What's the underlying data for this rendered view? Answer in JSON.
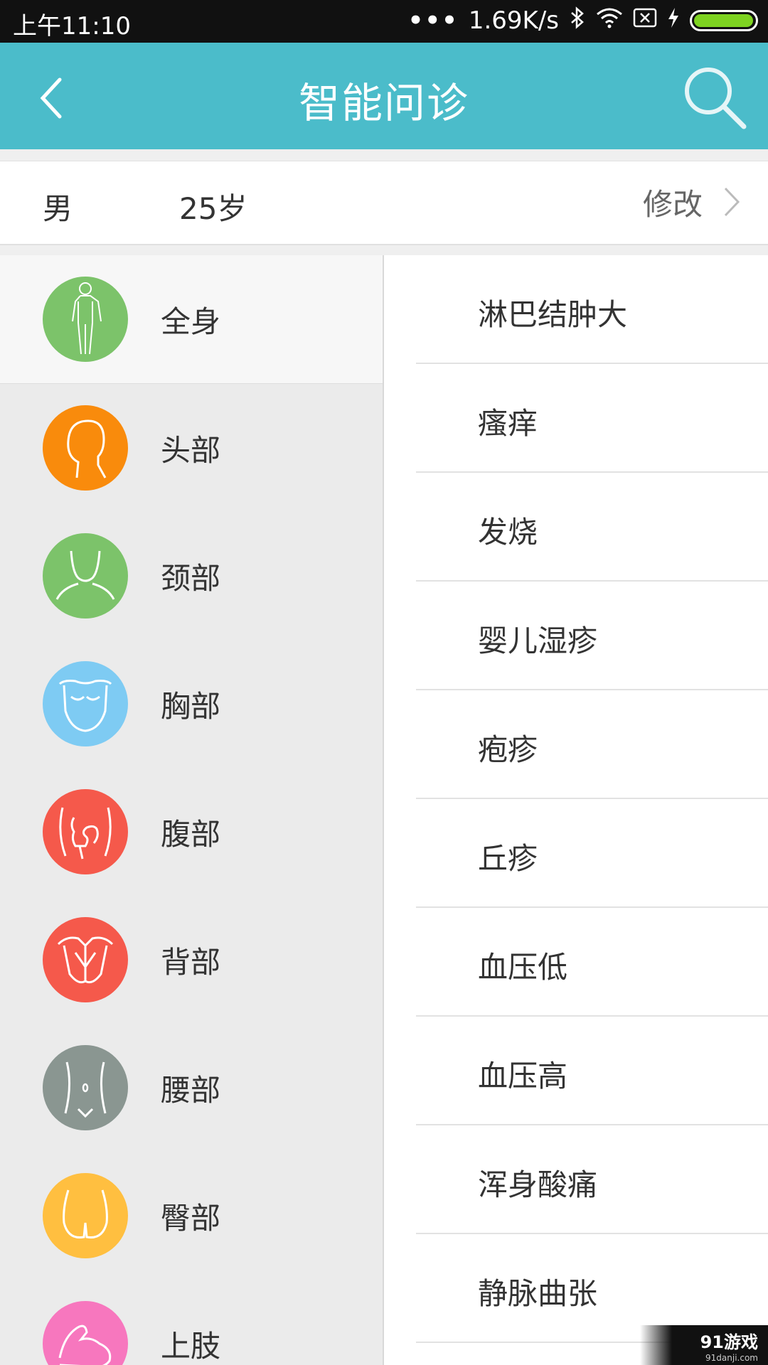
{
  "status_bar": {
    "time": "上午11:10",
    "dots": "•••",
    "speed": "1.69K/s",
    "icons": [
      "bluetooth-icon",
      "wifi-icon",
      "sim-x-icon",
      "charging-icon",
      "battery-icon"
    ]
  },
  "header": {
    "title": "智能问诊",
    "background": "#4bbcca"
  },
  "profile": {
    "gender": "男",
    "age": "25岁",
    "edit_label": "修改"
  },
  "body_parts": [
    {
      "label": "全身",
      "color": "#7cc36a",
      "icon": "full-body-icon",
      "active": true
    },
    {
      "label": "头部",
      "color": "#f98b0c",
      "icon": "head-icon"
    },
    {
      "label": "颈部",
      "color": "#7cc36a",
      "icon": "neck-icon"
    },
    {
      "label": "胸部",
      "color": "#7ecbf3",
      "icon": "chest-icon"
    },
    {
      "label": "腹部",
      "color": "#f5594b",
      "icon": "abdomen-icon"
    },
    {
      "label": "背部",
      "color": "#f5594b",
      "icon": "back-icon"
    },
    {
      "label": "腰部",
      "color": "#8a9691",
      "icon": "waist-icon"
    },
    {
      "label": "臀部",
      "color": "#ffbf40",
      "icon": "hip-icon"
    },
    {
      "label": "上肢",
      "color": "#f777be",
      "icon": "arm-icon"
    }
  ],
  "symptoms": [
    "淋巴结肿大",
    "瘙痒",
    "发烧",
    "婴儿湿疹",
    "疱疹",
    "丘疹",
    "血压低",
    "血压高",
    "浑身酸痛",
    "静脉曲张"
  ],
  "watermark": {
    "brand": "91游戏",
    "site": "91danji.com"
  }
}
